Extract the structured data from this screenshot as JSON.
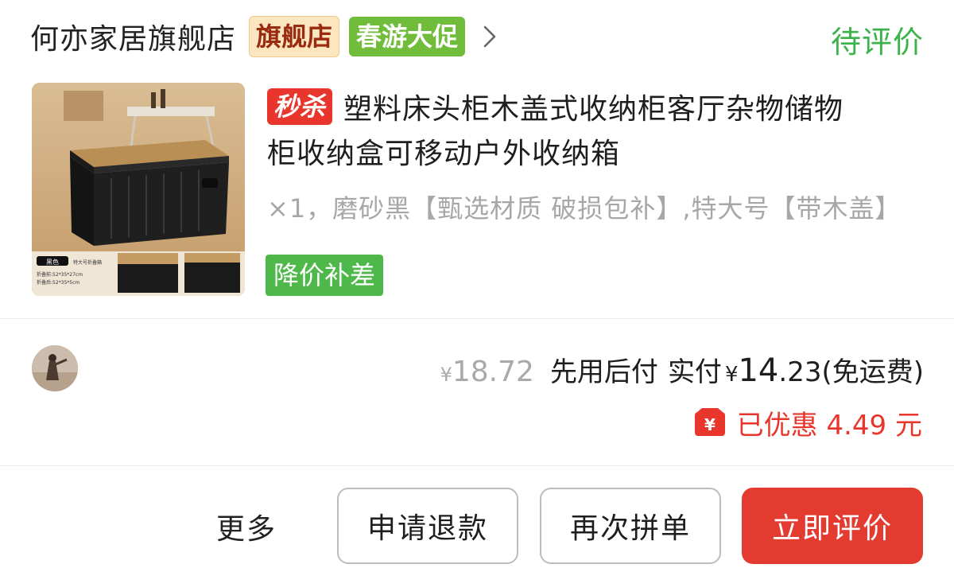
{
  "store": {
    "name": "何亦家居旗舰店",
    "flagship_badge": "旗舰店",
    "promo_badge": "春游大促",
    "status": "待评价"
  },
  "product": {
    "seckill_tag": "秒杀",
    "title_line1": "塑料床头柜木盖式收纳柜客厅杂物储物",
    "title_line2": "柜收纳盒可移动户外收纳箱",
    "spec": "×1，磨砂黑【甄选材质 破损包补】,特大号【带木盖】",
    "price_drop_tag": "降价补差",
    "thumbnail": {
      "color_label": "黑色",
      "size_label": "特大号折叠箱",
      "before_fold": "折叠前:52*35*27cm",
      "after_fold": "折叠后:52*35*5cm"
    }
  },
  "price": {
    "currency": "¥",
    "original": "18.72",
    "pay_later": "先用后付",
    "actual_label": "实付",
    "actual_int": "14",
    "actual_dec": ".23",
    "free_shipping": "(免运费)",
    "discount_text": "已优惠 4.49 元",
    "discount_icon": "yen-coupon-icon"
  },
  "actions": {
    "more": "更多",
    "refund": "申请退款",
    "reorder": "再次拼单",
    "review": "立即评价"
  },
  "colors": {
    "accent_red": "#e33b2f",
    "status_green": "#3bb34a",
    "promo_green": "#6fbd3a",
    "muted_gray": "#a9a9a9"
  }
}
